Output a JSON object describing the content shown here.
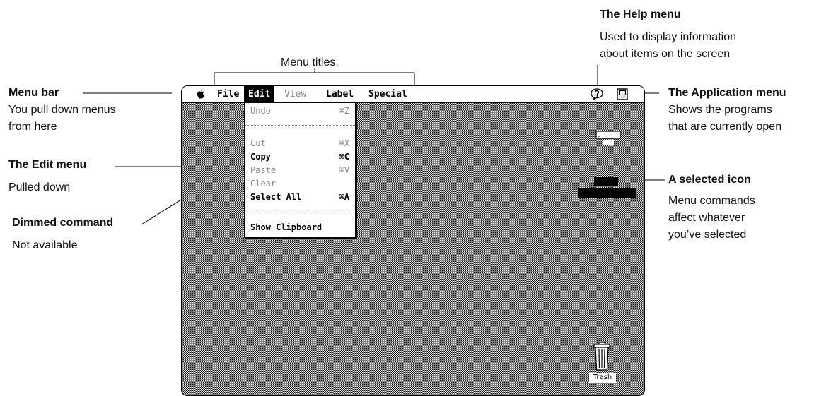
{
  "callouts": {
    "menu_titles": "Menu titles.",
    "menu_bar": {
      "head": "Menu bar",
      "desc": [
        "You pull down menus",
        "from here"
      ]
    },
    "edit_menu": {
      "head": "The Edit menu",
      "desc": "Pulled down"
    },
    "dimmed_command": {
      "head": "Dimmed command",
      "desc": "Not available"
    },
    "help_menu": {
      "head": "The Help menu",
      "desc": [
        "Used to display information",
        "about items on the screen"
      ]
    },
    "application_menu": {
      "head": "The Application menu",
      "desc": [
        "Shows the programs",
        "that are currently open"
      ]
    },
    "selected_icon": {
      "head": "A selected icon",
      "desc": [
        "Menu commands",
        "affect whatever",
        "you’ve selected"
      ]
    }
  },
  "menubar": {
    "apple_icon": "apple-icon",
    "titles": [
      "File",
      "Edit",
      "View",
      "Label",
      "Special"
    ],
    "active_title": "Edit",
    "dimmed_title": "View",
    "help_icon": "help-balloon-icon",
    "application_icon": "application-menu-icon"
  },
  "edit_menu": {
    "items": [
      {
        "label": "Undo",
        "shortcut": "⌘Z",
        "state": "dimmed"
      },
      {
        "label": "Cut",
        "shortcut": "⌘X",
        "state": "dimmed"
      },
      {
        "label": "Copy",
        "shortcut": "⌘C",
        "state": "enabled"
      },
      {
        "label": "Paste",
        "shortcut": "⌘V",
        "state": "dimmed"
      },
      {
        "label": "Clear",
        "shortcut": "",
        "state": "dimmed"
      },
      {
        "label": "Select All",
        "shortcut": "⌘A",
        "state": "enabled"
      },
      {
        "label": "Show Clipboard",
        "shortcut": "",
        "state": "enabled"
      }
    ]
  },
  "desktop": {
    "trash_label": "Trash",
    "pattern_colors": [
      "#000000",
      "#ffffff"
    ],
    "dim_color": "#8a8a8a"
  }
}
